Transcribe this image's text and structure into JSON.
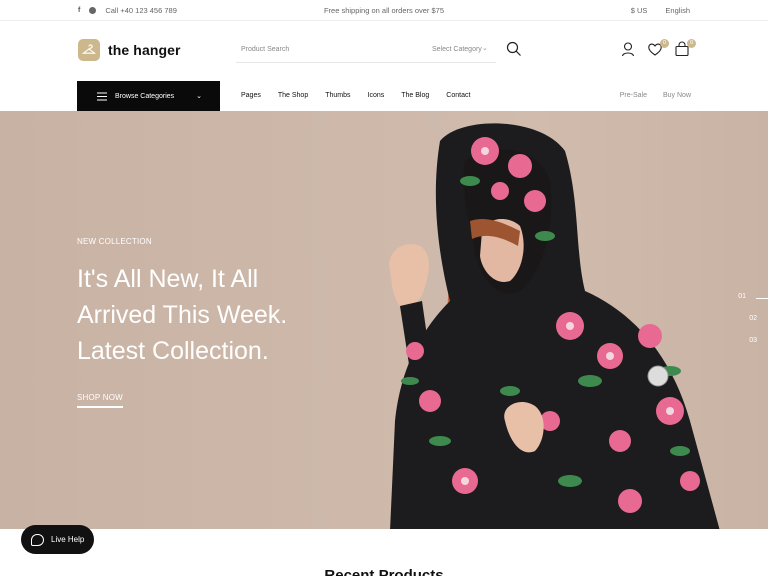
{
  "topbar": {
    "phone": "Call +40 123 456 789",
    "shipping": "Free shipping on all orders over $75",
    "currency": "$ US",
    "language": "English",
    "social": [
      "facebook-icon",
      "whatsapp-icon"
    ]
  },
  "header": {
    "logo": "the hanger",
    "search_placeholder": "Product Search",
    "category_placeholder": "Select Category",
    "wishlist_count": "0",
    "cart_count": "0"
  },
  "nav": {
    "browse": "Browse Categories",
    "items": [
      "Pages",
      "The Shop",
      "Thumbs",
      "Icons",
      "The Blog",
      "Contact"
    ],
    "right": [
      "Pre-Sale",
      "Buy Now"
    ]
  },
  "hero": {
    "kicker": "NEW COLLECTION",
    "headline": [
      "It's All New, It All",
      "Arrived This Week.",
      "Latest Collection."
    ],
    "cta": "SHOP NOW",
    "slides": [
      "01",
      "02",
      "03"
    ]
  },
  "livehelp": {
    "label": "Live Help"
  },
  "section": {
    "title": "Recent Products"
  },
  "colors": {
    "accent": "#cdb88d",
    "hero_bg": "#cab4a6",
    "dark": "#0a0a0a"
  }
}
